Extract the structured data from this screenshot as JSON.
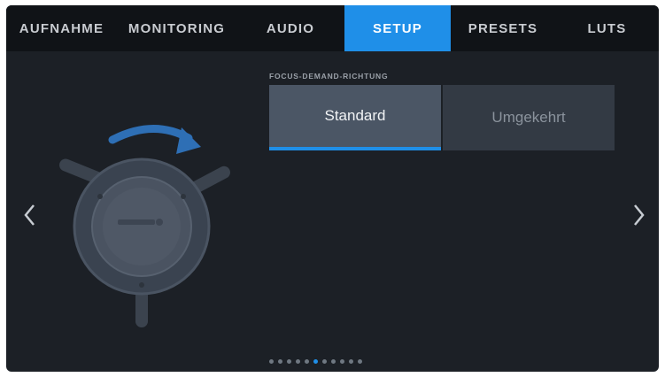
{
  "tabs": [
    {
      "label": "AUFNAHME",
      "active": false
    },
    {
      "label": "MONITORING",
      "active": false
    },
    {
      "label": "AUDIO",
      "active": false
    },
    {
      "label": "SETUP",
      "active": true
    },
    {
      "label": "PRESETS",
      "active": false
    },
    {
      "label": "LUTS",
      "active": false
    }
  ],
  "setting": {
    "label": "FOCUS-DEMAND-RICHTUNG",
    "options": [
      "Standard",
      "Umgekehrt"
    ],
    "selected": "Standard"
  },
  "page_indicator": {
    "total": 11,
    "current": 6
  },
  "colors": {
    "accent": "#1f8fe8",
    "background": "#1c2026",
    "tabbar": "#101317"
  },
  "icons": {
    "prev": "chevron-left-icon",
    "next": "chevron-right-icon",
    "illustration": "focus-demand-knob-icon"
  }
}
